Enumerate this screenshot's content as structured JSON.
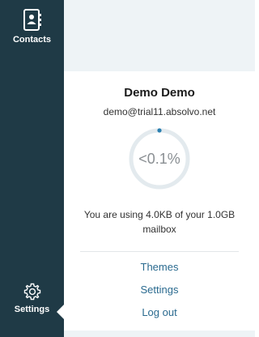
{
  "sidebar": {
    "items": [
      {
        "label": "Contacts",
        "icon": "contacts-book-icon"
      },
      {
        "label": "Settings",
        "icon": "gear-icon",
        "active": true
      }
    ]
  },
  "profile": {
    "name": "Demo Demo",
    "email": "demo@trial11.absolvo.net"
  },
  "usage": {
    "percent_label": "<0.1%",
    "percent_value": 0.001,
    "description": "You are using 4.0KB of your 1.0GB mailbox"
  },
  "menu": {
    "links": [
      "Themes",
      "Settings",
      "Log out"
    ]
  },
  "colors": {
    "sidebar": "#1f3a46",
    "accent": "#2a7fb0",
    "ring": "#e3eaee",
    "link": "#2a6a8f"
  }
}
